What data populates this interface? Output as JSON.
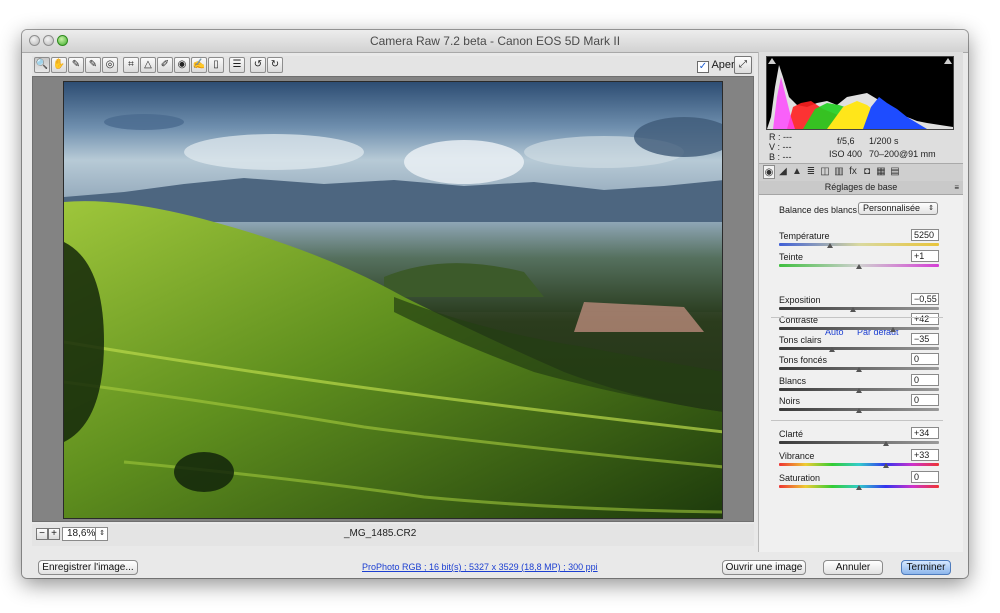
{
  "window": {
    "title": "Camera Raw 7.2 beta  -  Canon EOS 5D Mark II"
  },
  "toolbar": {
    "tools": [
      {
        "name": "zoom-tool",
        "icon": "🔍"
      },
      {
        "name": "hand-tool",
        "icon": "✋"
      },
      {
        "name": "white-balance-tool",
        "icon": "✎"
      },
      {
        "name": "color-sampler-tool",
        "icon": "✎"
      },
      {
        "name": "targeted-adjustment-tool",
        "icon": "◎"
      },
      {
        "name": "crop-tool",
        "icon": "⌗"
      },
      {
        "name": "straighten-tool",
        "icon": "△"
      },
      {
        "name": "spot-removal-tool",
        "icon": "✐"
      },
      {
        "name": "red-eye-tool",
        "icon": "◉"
      },
      {
        "name": "adjustment-brush-tool",
        "icon": "✍"
      },
      {
        "name": "graduated-filter-tool",
        "icon": "▯"
      },
      {
        "name": "preferences-tool",
        "icon": "☰"
      },
      {
        "name": "rotate-left-tool",
        "icon": "↺"
      },
      {
        "name": "rotate-right-tool",
        "icon": "↻"
      }
    ],
    "preview_label": "Aperçu",
    "preview_checked": true
  },
  "status": {
    "zoom_value": "18,6%",
    "zoom_minus": "−",
    "zoom_plus": "+",
    "filename": "_MG_1485.CR2"
  },
  "histogram": {
    "clip_shadow_warning": true,
    "clip_highlight_warning": true
  },
  "readouts": {
    "r_label": "R :",
    "r_value": "---",
    "v_label": "V :",
    "v_value": "---",
    "b_label": "B :",
    "b_value": "---",
    "aperture": "f/5,6",
    "shutter": "1/200 s",
    "iso": "ISO 400",
    "lens": "70–200@91 mm"
  },
  "panel": {
    "title": "Réglages de base",
    "tabs": [
      {
        "name": "basic-tab-icon",
        "icon": "◉"
      },
      {
        "name": "tone-curve-tab-icon",
        "icon": "◢"
      },
      {
        "name": "detail-tab-icon",
        "icon": "▲"
      },
      {
        "name": "hsl-tab-icon",
        "icon": "≣"
      },
      {
        "name": "split-toning-tab-icon",
        "icon": "◫"
      },
      {
        "name": "lens-corrections-tab-icon",
        "icon": "▥"
      },
      {
        "name": "effects-tab-icon",
        "icon": "fx"
      },
      {
        "name": "camera-calibration-tab-icon",
        "icon": "◘"
      },
      {
        "name": "presets-tab-icon",
        "icon": "▦"
      },
      {
        "name": "snapshots-tab-icon",
        "icon": "▤"
      }
    ],
    "wb_label": "Balance des blancs :",
    "wb_value": "Personnalisée",
    "auto_label": "Auto",
    "default_label": "Par défaut",
    "sliders": [
      {
        "label": "Température",
        "value": "5250",
        "pos": 0.32,
        "track": "temp"
      },
      {
        "label": "Teinte",
        "value": "+1",
        "pos": 0.5,
        "track": "tint"
      },
      {
        "label": "Exposition",
        "value": "−0,55",
        "pos": 0.46,
        "track": "gray"
      },
      {
        "label": "Contraste",
        "value": "+42",
        "pos": 0.71,
        "track": "gray"
      },
      {
        "label": "Tons clairs",
        "value": "−35",
        "pos": 0.33,
        "track": "gray"
      },
      {
        "label": "Tons foncés",
        "value": "0",
        "pos": 0.5,
        "track": "gray"
      },
      {
        "label": "Blancs",
        "value": "0",
        "pos": 0.5,
        "track": "gray"
      },
      {
        "label": "Noirs",
        "value": "0",
        "pos": 0.5,
        "track": "gray"
      },
      {
        "label": "Clarté",
        "value": "+34",
        "pos": 0.67,
        "track": "gray"
      },
      {
        "label": "Vibrance",
        "value": "+33",
        "pos": 0.67,
        "track": "rainbow"
      },
      {
        "label": "Saturation",
        "value": "0",
        "pos": 0.5,
        "track": "rainbow"
      }
    ]
  },
  "bottom": {
    "save_label": "Enregistrer l'image...",
    "workflow_link": "ProPhoto RGB ; 16 bit(s) ; 5327 x 3529 (18,8 MP) ; 300 ppi",
    "open_label": "Ouvrir une image",
    "cancel_label": "Annuler",
    "done_label": "Terminer"
  },
  "colors": {
    "link": "#1c3fd1",
    "primary_button": "#8db6ec",
    "accent_check": "#1f5fd1"
  }
}
